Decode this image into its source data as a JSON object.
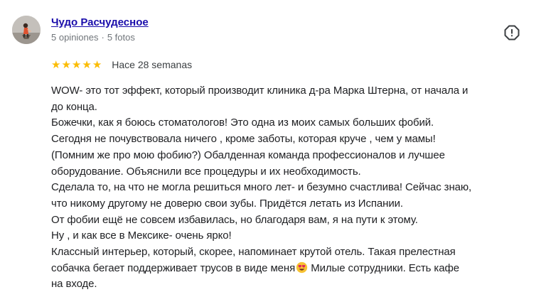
{
  "author": {
    "name": "Чудо Расчудесное",
    "reviews_count": "5 opiniones",
    "separator": "·",
    "photos_count": "5 fotos",
    "avatar_icon": "user-photo-avatar"
  },
  "report": {
    "icon": "report-exclamation-icon"
  },
  "rating": {
    "stars": 5,
    "max_stars": 5,
    "star_glyph": "★",
    "star_color": "#fbbc04",
    "date": "Hace 28 semanas"
  },
  "review": {
    "lines": [
      "WOW- это тот эффект, который производит клиника д-ра Марка Штерна, от начала и",
      "до конца.",
      "Божечки, как я боюсь стоматологов! Это одна из моих самых больших фобий.",
      "Сегодня не почувствовала ничего , кроме заботы, которая круче , чем у мамы!",
      "(Помним же про мою фобию?) Обалденная команда профессионалов и лучшее",
      "оборудование. Объяснили все процедуры и их необходимость.",
      "Сделала то, на что не могла решиться много лет- и безумно счастлива!  Сейчас знаю,",
      "что никому другому не доверю свои зубы. Придётся летать из Испании.",
      "От фобии ещё не совсем избавилась, но благодаря вам, я на пути к этому.",
      "Ну , и как все в Мексике- очень ярко!",
      "Классный интерьер, который, скорее,  напоминает крутой отель. Такая прелестная"
    ],
    "line12_before_emoji": "собачка бегает поддерживает трусов в виде меня",
    "line12_emoji": "smiling-face-with-heart-eyes-emoji",
    "line12_after_emoji": " Милые сотрудники.  Есть кафе",
    "line13": "на входе."
  },
  "colors": {
    "author_link": "#1a0dab",
    "meta_text": "#70757a",
    "body_text": "#202124"
  }
}
